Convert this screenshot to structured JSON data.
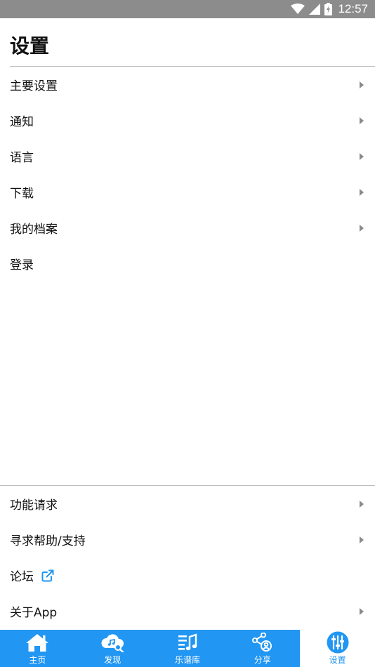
{
  "status_bar": {
    "time": "12:57"
  },
  "page": {
    "title": "设置"
  },
  "menu_top": [
    {
      "label": "主要设置",
      "chevron": true
    },
    {
      "label": "通知",
      "chevron": true
    },
    {
      "label": "语言",
      "chevron": true
    },
    {
      "label": "下载",
      "chevron": true
    },
    {
      "label": "我的档案",
      "chevron": true
    },
    {
      "label": "登录",
      "chevron": false
    }
  ],
  "menu_bottom": [
    {
      "label": "功能请求",
      "chevron": true
    },
    {
      "label": "寻求帮助/支持",
      "chevron": true
    },
    {
      "label": "论坛",
      "chevron": false,
      "icon": "external-link-icon"
    },
    {
      "label": "关于App",
      "chevron": true
    }
  ],
  "tabs": [
    {
      "label": "主页",
      "icon": "home-icon"
    },
    {
      "label": "发现",
      "icon": "cloud-music-search-icon"
    },
    {
      "label": "乐谱库",
      "icon": "music-library-icon"
    },
    {
      "label": "分享",
      "icon": "share-icon"
    },
    {
      "label": "设置",
      "icon": "settings-sliders-icon",
      "active": true
    }
  ],
  "colors": {
    "accent": "#2196f3",
    "status_bar": "#8c8c8c",
    "divider": "#bdbdbd"
  }
}
